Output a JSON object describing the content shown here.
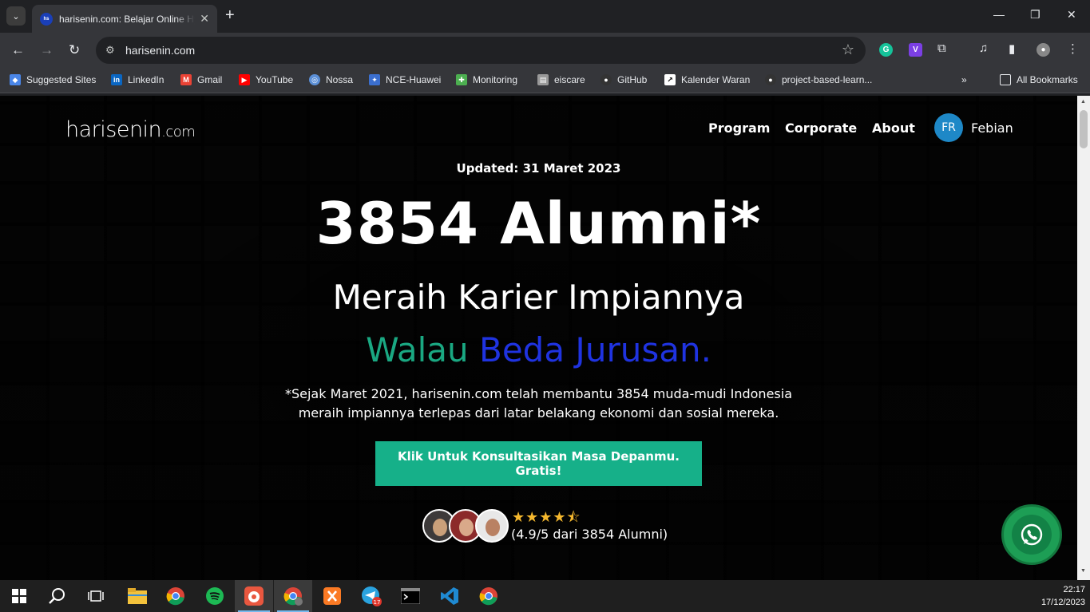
{
  "browser": {
    "tab_title": "harisenin.com: Belajar Online Hybrid",
    "url": "harisenin.com",
    "bookmarks": [
      "Suggested Sites",
      "LinkedIn",
      "Gmail",
      "YouTube",
      "Nossa",
      "NCE-Huawei",
      "Monitoring",
      "eiscare",
      "GitHub",
      "Kalender Waran",
      "project-based-learn...",
      "All Bookmarks"
    ]
  },
  "site": {
    "logo_main": "harisenin",
    "logo_domain": ".com",
    "nav": [
      "Program",
      "Corporate",
      "About"
    ],
    "user_initials": "FR",
    "user_name": "Febian"
  },
  "hero": {
    "updated": "Updated: 31 Maret 2023",
    "headline": "3854 Alumni*",
    "subtitle1": "Meraih Karier Impiannya",
    "subtitle2_green": "Walau",
    "subtitle2_blue": "Beda Jurusan.",
    "description": "*Sejak Maret 2021, harisenin.com telah membantu 3854 muda-mudi Indonesia meraih impiannya terlepas dari latar belakang ekonomi dan sosial mereka.",
    "cta": "Klik Untuk Konsultasikan Masa Depanmu. Gratis!",
    "stars": "★★★★⯪",
    "rating_value": 4.9,
    "rating_text": "(4.9/5 dari 3854 Alumni)"
  },
  "taskbar": {
    "time": "22:17",
    "date": "17/12/2023",
    "telegram_badge": "17"
  },
  "colors": {
    "cta": "#16b089",
    "green_text": "#1aa882",
    "blue_text": "#1f33e0",
    "avatar": "#1e88c7",
    "whatsapp": "#1d9e55"
  }
}
